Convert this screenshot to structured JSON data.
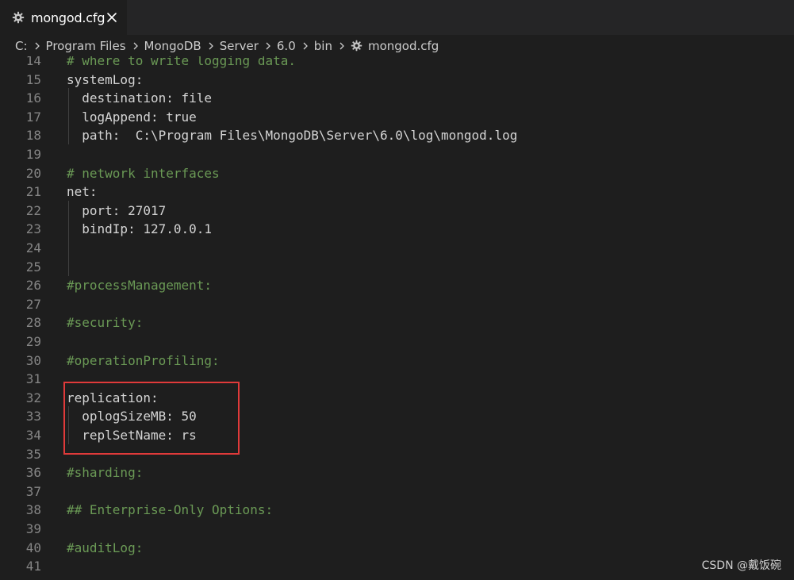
{
  "tab": {
    "label": "mongod.cfg",
    "icon": "gear-icon",
    "close_icon": "close-icon"
  },
  "breadcrumb": {
    "items": [
      "C:",
      "Program Files",
      "MongoDB",
      "Server",
      "6.0",
      "bin",
      "mongod.cfg"
    ]
  },
  "editor": {
    "lines": [
      {
        "n": "14",
        "text": "# where to write logging data.",
        "kind": "comment"
      },
      {
        "n": "15",
        "text": "systemLog:",
        "kind": "code"
      },
      {
        "n": "16",
        "text": "  destination: file",
        "kind": "code"
      },
      {
        "n": "17",
        "text": "  logAppend: true",
        "kind": "code"
      },
      {
        "n": "18",
        "text": "  path:  C:\\Program Files\\MongoDB\\Server\\6.0\\log\\mongod.log",
        "kind": "code"
      },
      {
        "n": "19",
        "text": "",
        "kind": "code"
      },
      {
        "n": "20",
        "text": "# network interfaces",
        "kind": "comment"
      },
      {
        "n": "21",
        "text": "net:",
        "kind": "code"
      },
      {
        "n": "22",
        "text": "  port: 27017",
        "kind": "code"
      },
      {
        "n": "23",
        "text": "  bindIp: 127.0.0.1",
        "kind": "code"
      },
      {
        "n": "24",
        "text": "",
        "kind": "code"
      },
      {
        "n": "25",
        "text": "",
        "kind": "code"
      },
      {
        "n": "26",
        "text": "#processManagement:",
        "kind": "comment"
      },
      {
        "n": "27",
        "text": "",
        "kind": "code"
      },
      {
        "n": "28",
        "text": "#security:",
        "kind": "comment"
      },
      {
        "n": "29",
        "text": "",
        "kind": "code"
      },
      {
        "n": "30",
        "text": "#operationProfiling:",
        "kind": "comment"
      },
      {
        "n": "31",
        "text": "",
        "kind": "code"
      },
      {
        "n": "32",
        "text": "replication:",
        "kind": "code"
      },
      {
        "n": "33",
        "text": "  oplogSizeMB: 50",
        "kind": "code"
      },
      {
        "n": "34",
        "text": "  replSetName: rs",
        "kind": "code"
      },
      {
        "n": "35",
        "text": "",
        "kind": "code"
      },
      {
        "n": "36",
        "text": "#sharding:",
        "kind": "comment"
      },
      {
        "n": "37",
        "text": "",
        "kind": "code"
      },
      {
        "n": "38",
        "text": "## Enterprise-Only Options:",
        "kind": "comment"
      },
      {
        "n": "39",
        "text": "",
        "kind": "code"
      },
      {
        "n": "40",
        "text": "#auditLog:",
        "kind": "comment"
      },
      {
        "n": "41",
        "text": "",
        "kind": "code"
      }
    ]
  },
  "watermark": "CSDN @戴饭碗",
  "colors": {
    "highlight_border": "#e03a3a",
    "comment": "#6a9955",
    "text": "#d4d4d4",
    "line_number": "#858585"
  }
}
